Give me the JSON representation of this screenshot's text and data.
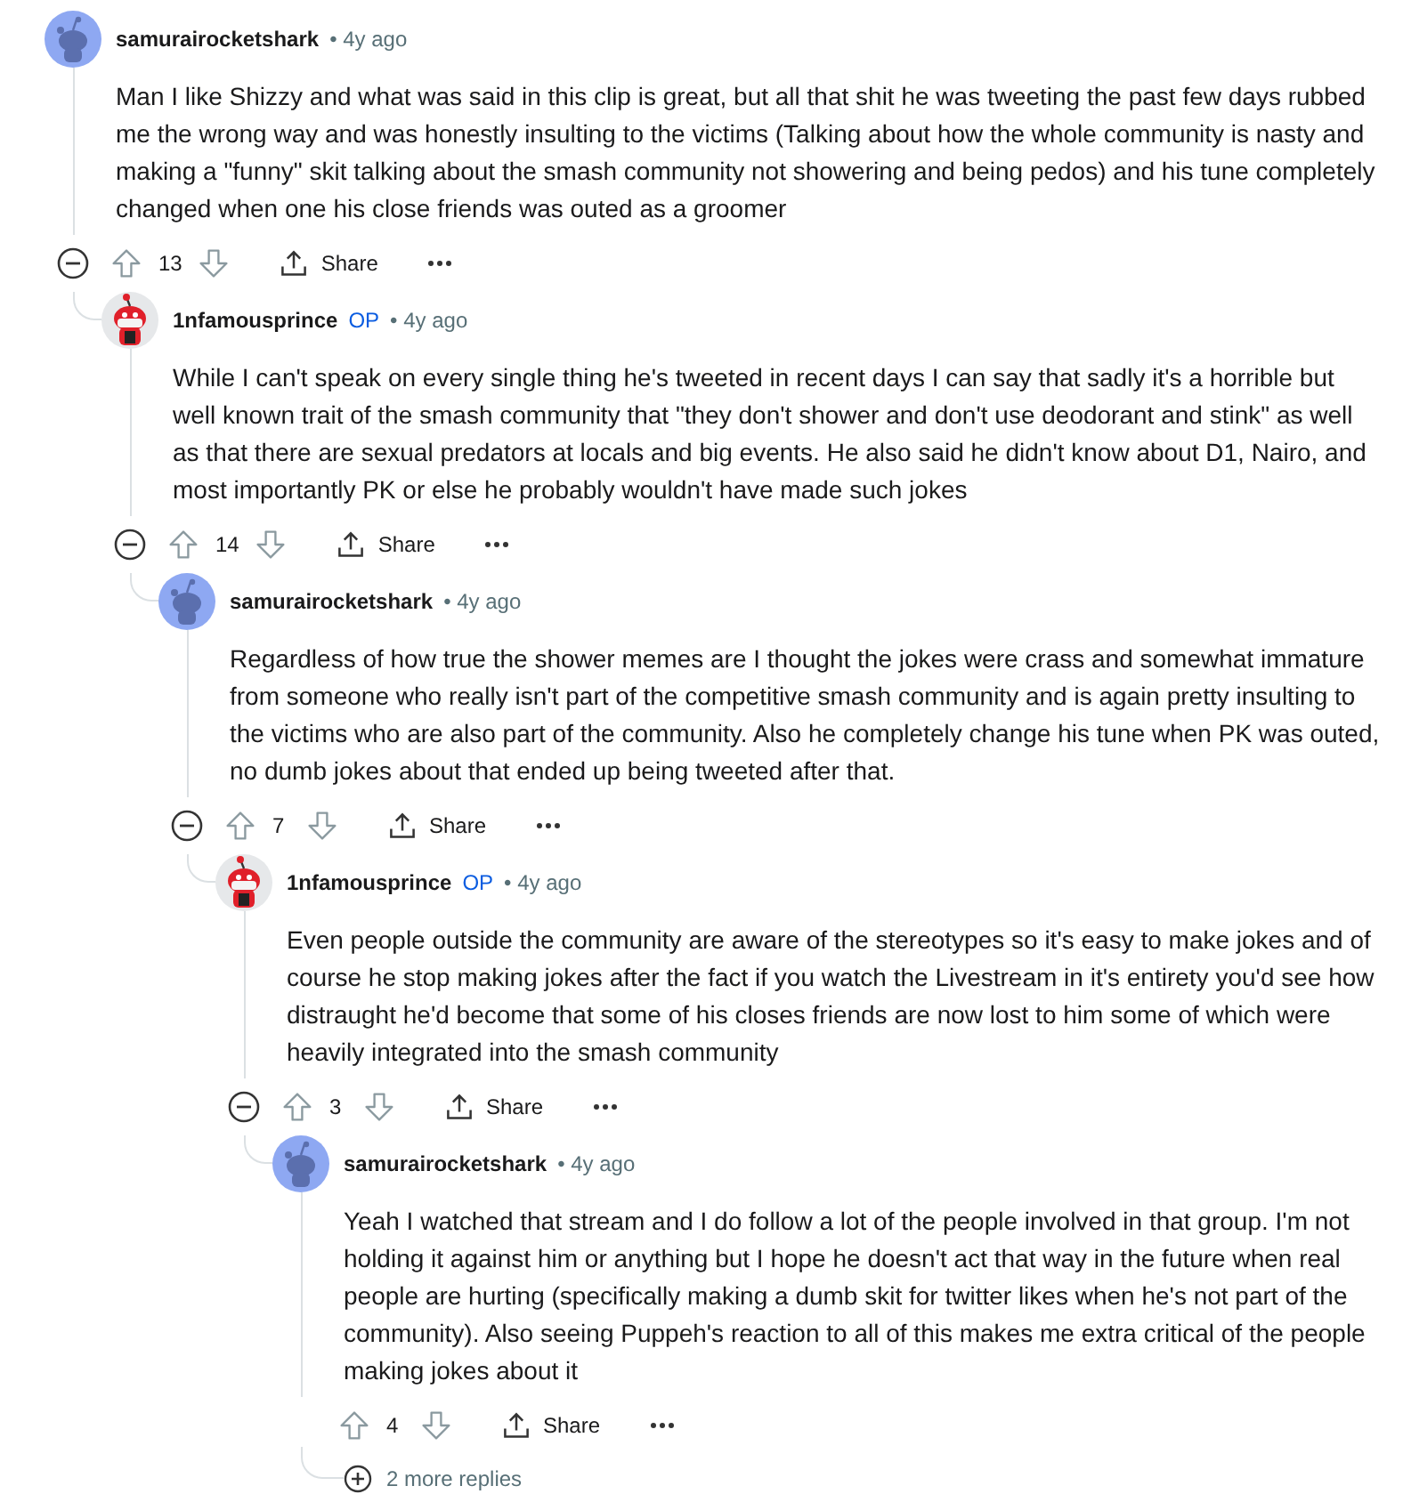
{
  "comments": [
    {
      "author": "samurairocketshark",
      "avatar": {
        "kind": "default"
      },
      "age": "• 4y ago",
      "text": "Man I like Shizzy and what was said in this clip is great, but all that shit he was tweeting the past few days rubbed me the wrong way and was honestly insulting to the victims (Talking about how the whole community is nasty and making a \"funny\" skit talking about the smash community not showering and being pedos) and his tune completely changed when one his close friends was outed as a groomer",
      "score": "13",
      "share": "Share",
      "children": [
        {
          "author": "1nfamousprince",
          "badge": "OP",
          "avatar": {
            "kind": "custom"
          },
          "age": "• 4y ago",
          "text": "While I can't speak on every single thing he's tweeted in recent days I can say that sadly it's a horrible but well known trait of the smash community that \"they don't shower and don't use deodorant and stink\" as well as that there are sexual predators at locals and big events. He also said he didn't know about D1, Nairo, and most importantly PK or else he probably wouldn't have made such jokes",
          "score": "14",
          "share": "Share",
          "children": [
            {
              "author": "samurairocketshark",
              "avatar": {
                "kind": "default"
              },
              "age": "• 4y ago",
              "text": "Regardless of how true the shower memes are I thought the jokes were crass and somewhat immature from someone who really isn't part of the competitive smash community and is again pretty insulting to the victims who are also part of the community. Also he completely change his tune when PK was outed, no dumb jokes about that ended up being tweeted after that.",
              "score": "7",
              "share": "Share",
              "children": [
                {
                  "author": "1nfamousprince",
                  "badge": "OP",
                  "avatar": {
                    "kind": "custom"
                  },
                  "age": "• 4y ago",
                  "text": "Even people outside the community are aware of the stereotypes so it's easy to make jokes and of course he stop making jokes after the fact if you watch the Livestream in it's entirety you'd see how distraught he'd become that some of his closes friends are now lost to him some of which were heavily integrated into the smash community",
                  "score": "3",
                  "share": "Share",
                  "children": [
                    {
                      "author": "samurairocketshark",
                      "avatar": {
                        "kind": "default"
                      },
                      "age": "• 4y ago",
                      "text": "Yeah I watched that stream and I do follow a lot of the people involved in that group. I'm not holding it against him or anything but I hope he doesn't act that way in the future when real people are hurting (specifically making a dumb skit for twitter likes when he's not part of the community). Also seeing Puppeh's reaction to all of this makes me extra critical of the people making jokes about it",
                      "score": "4",
                      "share": "Share",
                      "more_replies": "2 more replies"
                    }
                  ]
                }
              ]
            }
          ]
        }
      ]
    }
  ]
}
